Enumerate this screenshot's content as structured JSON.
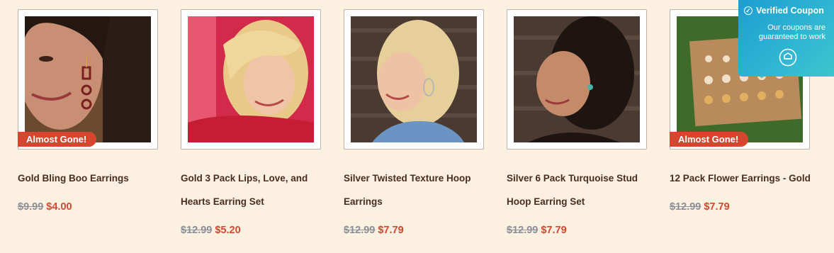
{
  "products": [
    {
      "title_line1": "Gold Bling Boo Earrings",
      "title_line2": "",
      "old_price": "$9.99",
      "new_price": "$4.00",
      "badge": "Almost Gone!"
    },
    {
      "title_line1": "Gold 3 Pack Lips, Love, and",
      "title_line2": "Hearts Earring Set",
      "old_price": "$12.99",
      "new_price": "$5.20",
      "badge": ""
    },
    {
      "title_line1": "Silver Twisted Texture Hoop",
      "title_line2": "Earrings",
      "old_price": "$12.99",
      "new_price": "$7.79",
      "badge": ""
    },
    {
      "title_line1": "Silver 6 Pack Turquoise Stud",
      "title_line2": "Hoop Earring Set",
      "old_price": "$12.99",
      "new_price": "$7.79",
      "badge": ""
    },
    {
      "title_line1": "12 Pack Flower Earrings - Gold",
      "title_line2": "",
      "old_price": "$12.99",
      "new_price": "$7.79",
      "badge": "Almost Gone!"
    }
  ],
  "coupon": {
    "title": "Verified Coupon",
    "subtitle": "Our coupons are guaranteed to work",
    "check_icon": "check-circle-icon",
    "tag_icon": "coupon-tag-icon"
  },
  "colors": {
    "background": "#fcf1e1",
    "sale": "#d8452f",
    "title": "#4a2c20",
    "coupon": "#1c9ed2"
  }
}
